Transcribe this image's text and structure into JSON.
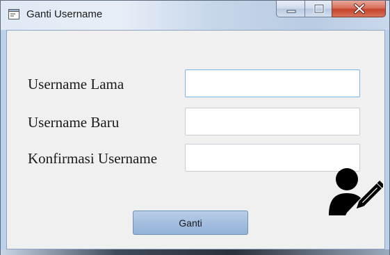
{
  "window": {
    "title": "Ganti Username",
    "icon": "form-icon",
    "caption_buttons": [
      "minimize-icon",
      "maximize-icon",
      "close-icon"
    ]
  },
  "form": {
    "fields": [
      {
        "label": "Username Lama",
        "value": ""
      },
      {
        "label": "Username Baru",
        "value": ""
      },
      {
        "label": "Konfirmasi Username",
        "value": ""
      }
    ],
    "submit_label": "Ganti",
    "decor_icon": "user-edit-icon"
  },
  "colors": {
    "window_chrome": "#b9d1ea",
    "client_bg": "#f0f0f0",
    "button_bg": "#a3bedf",
    "close_btn": "#c4452b",
    "icon": "#000000"
  }
}
